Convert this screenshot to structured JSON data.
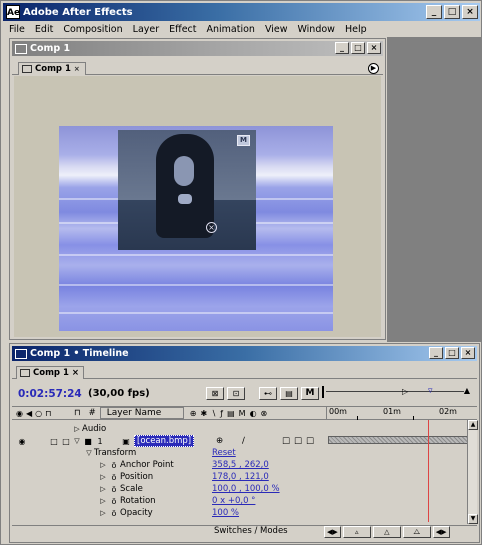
{
  "app": {
    "title": "Adobe After Effects",
    "icon": "Ae",
    "window_controls": [
      "_",
      "□",
      "×"
    ]
  },
  "menu": [
    "File",
    "Edit",
    "Composition",
    "Layer",
    "Effect",
    "Animation",
    "View",
    "Window",
    "Help"
  ],
  "comp_window": {
    "title": "Comp 1",
    "tab": "Comp 1",
    "tab_close": "×",
    "window_controls": [
      "_",
      "□",
      "×"
    ],
    "tab_menu_arrow": "▶",
    "footage_logo": "M"
  },
  "timeline": {
    "title": "Comp 1 • Timeline",
    "tab": "Comp 1",
    "tab_close": "×",
    "window_controls": [
      "_",
      "□",
      "×"
    ],
    "timecode": "0:02:57:24",
    "fps": "(30,00 fps)",
    "toolbar": {
      "m_button": "M"
    },
    "columns": {
      "label": "#",
      "layer_name": "Layer Name"
    },
    "ruler": [
      "00m",
      "01m",
      "02m"
    ],
    "switches_label": "Switches / Modes",
    "layers": [
      {
        "row": "Audio",
        "kind": "group"
      },
      {
        "number": "1",
        "name": "[ocean.bmp]",
        "kind": "layer"
      },
      {
        "row": "Transform",
        "kind": "group"
      }
    ],
    "properties": [
      {
        "name": "Anchor Point",
        "value": "358,5 , 262,0"
      },
      {
        "name": "Position",
        "value": "178,0 , 121,0"
      },
      {
        "name": "Scale",
        "value": "100,0 , 100,0 %"
      },
      {
        "name": "Rotation",
        "value": "0 x +0,0 °"
      },
      {
        "name": "Opacity",
        "value": "100 %"
      }
    ],
    "reset": "Reset"
  }
}
